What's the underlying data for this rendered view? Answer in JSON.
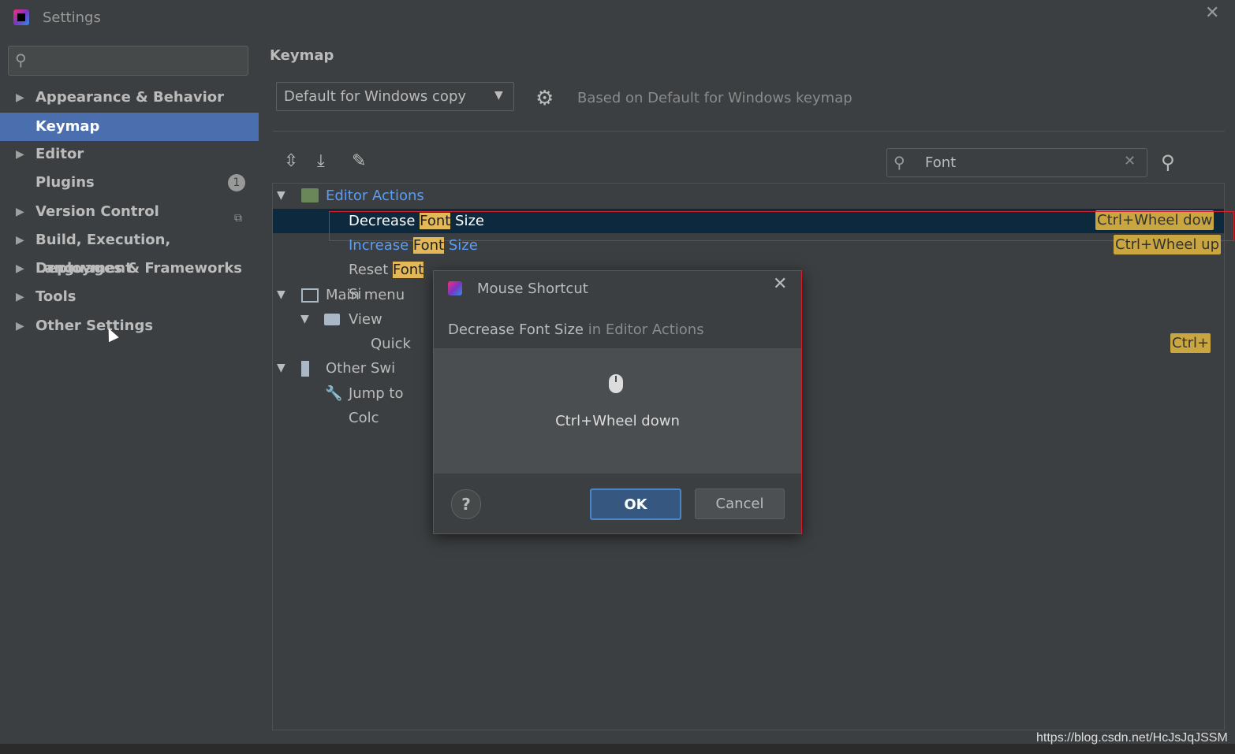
{
  "window": {
    "title": "Settings"
  },
  "sidebar": {
    "search_placeholder": "",
    "items": [
      {
        "label": "Appearance & Behavior",
        "expandable": true
      },
      {
        "label": "Keymap",
        "selected": true
      },
      {
        "label": "Editor",
        "expandable": true
      },
      {
        "label": "Plugins",
        "badge": "1"
      },
      {
        "label": "Version Control",
        "expandable": true
      },
      {
        "label": "Build, Execution, Deployment",
        "expandable": true
      },
      {
        "label": "Languages & Frameworks",
        "expandable": true
      },
      {
        "label": "Tools",
        "expandable": true
      },
      {
        "label": "Other Settings",
        "expandable": true
      }
    ]
  },
  "main": {
    "title": "Keymap",
    "keymap_select": "Default for Windows copy",
    "based_on": "Based on Default for Windows keymap",
    "search_value": "Font",
    "tree": {
      "editor_actions": "Editor Actions",
      "decrease": {
        "pre": "Decrease ",
        "hl": "Font",
        "post": " Size",
        "shortcut": "Ctrl+Wheel dow"
      },
      "increase": {
        "pre": "Increase ",
        "hl": "Font",
        "post": " Size",
        "shortcut": "Ctrl+Wheel up"
      },
      "reset": {
        "pre": "Reset ",
        "hl": "Font",
        "post": " Si"
      },
      "main_menu": "Main menu",
      "view": "View",
      "quick_switch": "Quick Swi",
      "quick_switch_shortcut": "Ctrl+",
      "other": "Other",
      "jump_to_color": "Jump to Colc"
    }
  },
  "dialog": {
    "title": "Mouse Shortcut",
    "action": "Decrease Font Size",
    "context": "in Editor Actions",
    "shortcut": "Ctrl+Wheel down",
    "help": "?",
    "ok": "OK",
    "cancel": "Cancel"
  },
  "watermark": "https://blog.csdn.net/HcJsJqJSSM"
}
